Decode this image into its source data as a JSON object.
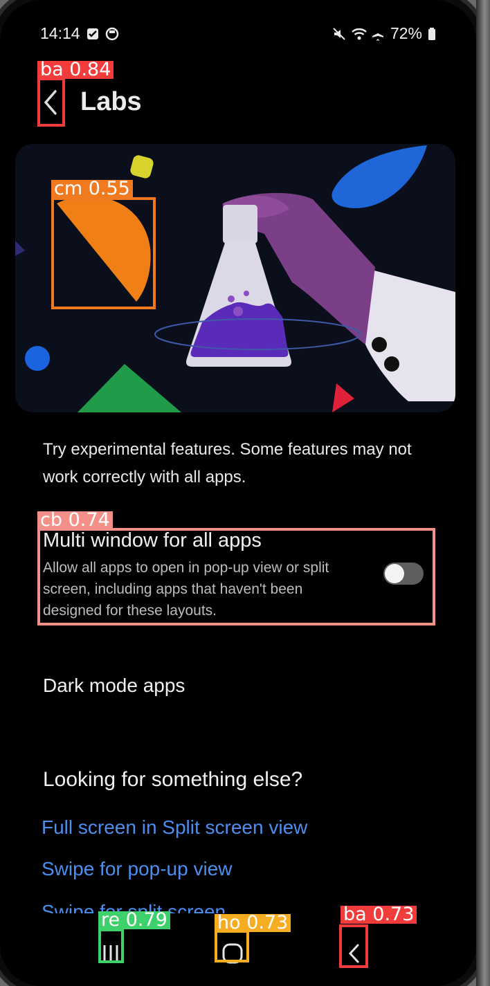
{
  "status_bar": {
    "time": "14:14",
    "battery": "72%",
    "icons": [
      "checkbox-notification-icon",
      "media-notification-icon",
      "mute-icon",
      "wifi-icon",
      "airplane-icon",
      "battery-icon"
    ]
  },
  "app_bar": {
    "title": "Labs",
    "back_icon": "chevron-left-icon"
  },
  "description": "Try experimental features. Some features may not work correctly with all apps.",
  "settings": {
    "multi_window": {
      "title": "Multi window for all apps",
      "summary": "Allow all apps to open in pop-up view or split screen, including apps that haven't been designed for these layouts.",
      "toggle_on": false
    },
    "dark_mode": {
      "title": "Dark mode apps"
    }
  },
  "looking_for": {
    "header": "Looking for something else?",
    "links": [
      "Full screen in Split screen view",
      "Swipe for pop-up view",
      "Swipe for split screen"
    ]
  },
  "nav_bar": {
    "recents_icon": "recents-icon",
    "home_icon": "home-icon",
    "back_icon": "back-icon"
  },
  "detections": [
    {
      "label": "ba 0.84",
      "color": "#f23b3b",
      "target": "app-bar-back-button"
    },
    {
      "label": "cm 0.55",
      "color": "#f07a1f",
      "target": "hero-illustration-half-circle"
    },
    {
      "label": "cb 0.74",
      "color": "#f4908a",
      "target": "multi-window-setting"
    },
    {
      "label": "re 0.79",
      "color": "#3ed06a",
      "target": "nav-recents-button"
    },
    {
      "label": "ho 0.73",
      "color": "#f6ad22",
      "target": "nav-home-button"
    },
    {
      "label": "ba 0.73",
      "color": "#f23b3b",
      "target": "nav-back-button"
    }
  ],
  "colors": {
    "background": "#000000",
    "link": "#4d8ff0",
    "toggle_track_off": "#5e5e5e"
  }
}
